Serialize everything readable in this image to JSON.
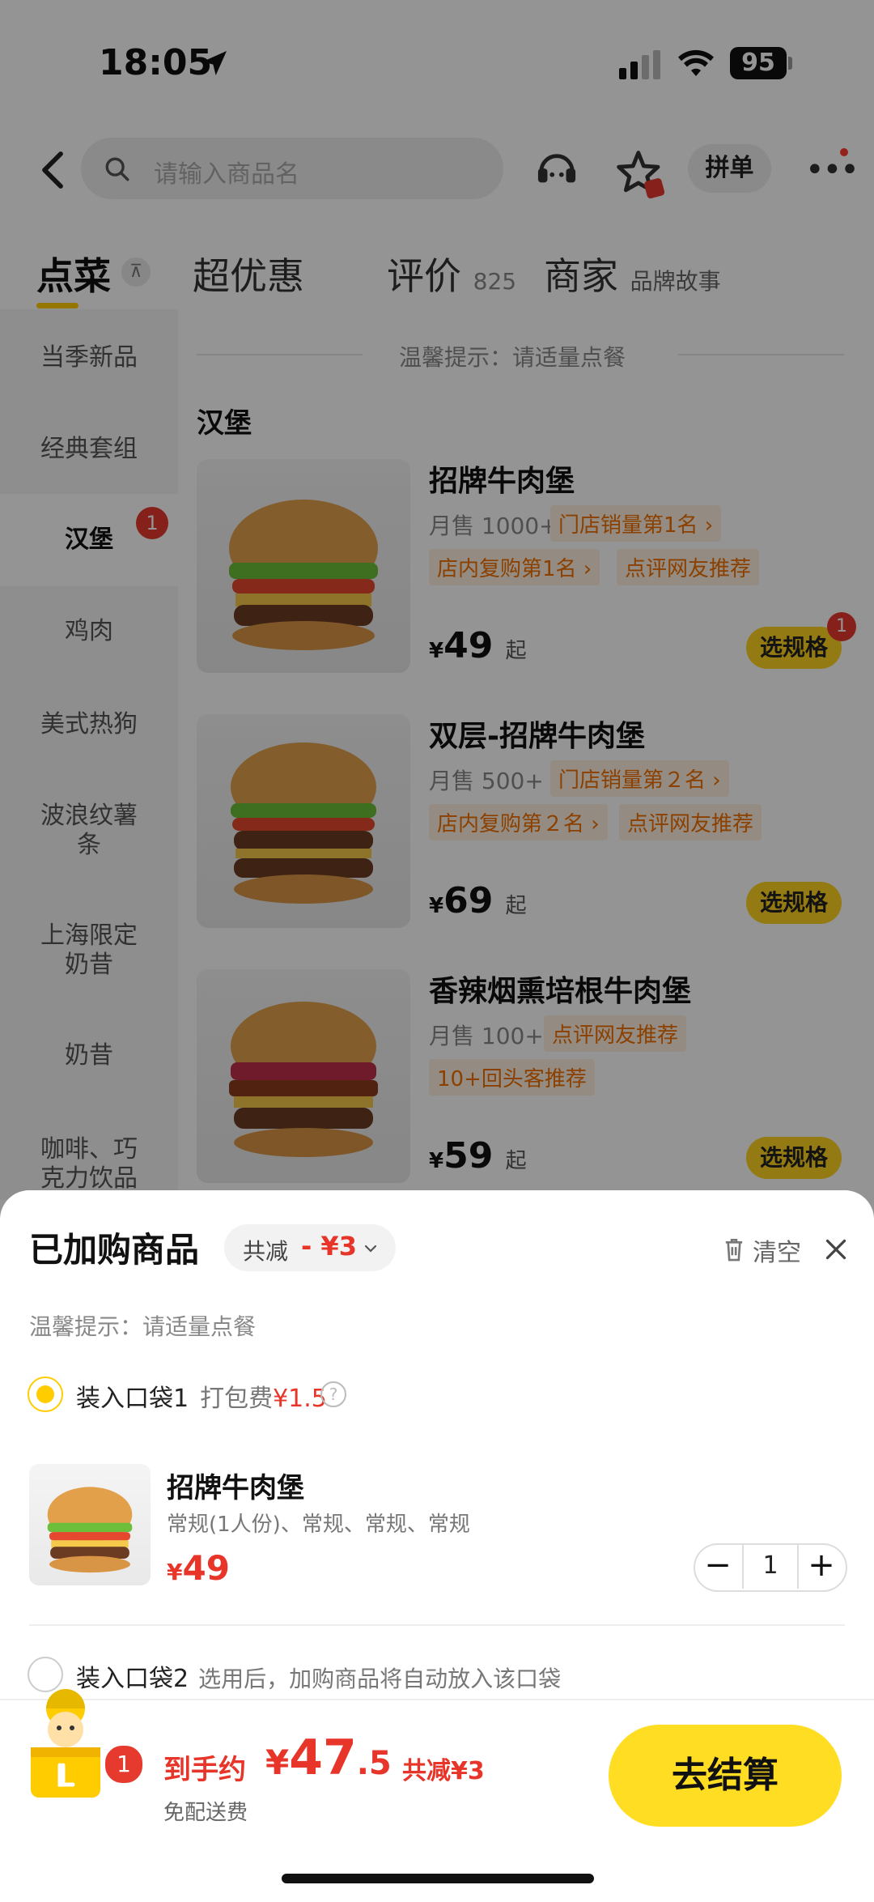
{
  "status": {
    "time": "18:05",
    "battery": "95"
  },
  "nav": {
    "search_placeholder": "请输入商品名",
    "group_order": "拼单"
  },
  "tabs": [
    {
      "label": "点菜"
    },
    {
      "label": "超优惠"
    },
    {
      "label": "评价",
      "count": "825"
    },
    {
      "label": "商家",
      "sub": "品牌故事"
    }
  ],
  "sidebar": {
    "items": [
      "当季新品",
      "经典套组",
      "汉堡",
      "鸡肉",
      "美式热狗",
      "波浪纹薯条",
      "上海限定奶昔",
      "奶昔",
      "咖啡、巧克力饮品"
    ],
    "active_badge": "1"
  },
  "menu": {
    "tip": "温馨提示：请适量点餐",
    "section": "汉堡",
    "products": [
      {
        "name": "招牌牛肉堡",
        "sales": "月售 1000+",
        "tags": [
          "门店销量第1名 ›",
          "店内复购第1名 ›",
          "点评网友推荐"
        ],
        "price": "49",
        "qi": "起",
        "button": "选规格",
        "badge": "1"
      },
      {
        "name": "双层-招牌牛肉堡",
        "sales": "月售 500+",
        "tags": [
          "门店销量第２名 ›",
          "店内复购第２名 ›",
          "点评网友推荐"
        ],
        "price": "69",
        "qi": "起",
        "button": "选规格"
      },
      {
        "name": "香辣烟熏培根牛肉堡",
        "sales": "月售 100+",
        "tags": [
          "点评网友推荐",
          "10+回头客推荐"
        ],
        "price": "59",
        "qi": "起",
        "button": "选规格"
      }
    ],
    "currency": "¥"
  },
  "sheet": {
    "title": "已加购商品",
    "discount_label": "共减",
    "discount_value": "- ¥3",
    "clear": "清空",
    "tip": "温馨提示：请适量点餐",
    "bag1": {
      "label": "装入口袋1",
      "fee_label": "打包费",
      "fee_value": "¥1.5"
    },
    "item": {
      "name": "招牌牛肉堡",
      "spec": "常规(1人份)、常规、常规、常规",
      "currency": "¥",
      "price": "49",
      "qty": "1"
    },
    "bag2": {
      "label": "装入口袋2",
      "hint": "选用后，加购商品将自动放入该口袋"
    }
  },
  "bottom": {
    "cart_count": "1",
    "pay_label": "到手约",
    "currency": "¥",
    "pay_int": "47",
    "pay_dec": ".5",
    "pay_discount": "共减¥3",
    "free_ship": "免配送费",
    "checkout": "去结算"
  },
  "colors": {
    "accent": "#ffd21f",
    "price_red": "#e8352a",
    "tag_orange": "#f06e00"
  }
}
